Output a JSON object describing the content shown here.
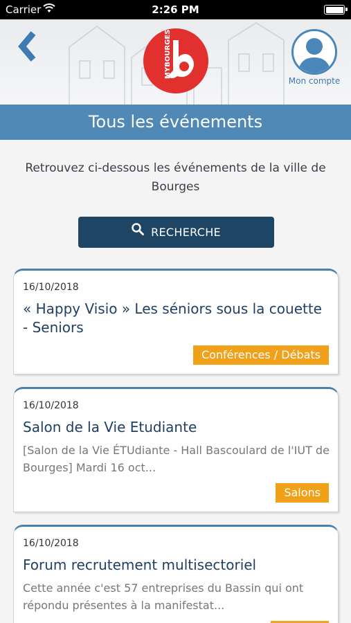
{
  "status_bar": {
    "carrier": "Carrier",
    "time": "2:26 PM"
  },
  "header": {
    "logo_text": "MYBOURGES",
    "account_label": "Mon compte"
  },
  "page": {
    "title": "Tous les événements",
    "intro": "Retrouvez ci-dessous les événements de la ville de Bourges",
    "search_label": "RECHERCHE"
  },
  "events": [
    {
      "date": "16/10/2018",
      "title": "« Happy Visio » Les séniors sous la couette - Seniors",
      "excerpt": "",
      "tag": "Conférences / Débats"
    },
    {
      "date": "16/10/2018",
      "title": "Salon de la Vie Etudiante",
      "excerpt": "[Salon de la Vie ÉTUdiante - Hall Bascoulard de l'IUT de Bourges]    Mardi 16 oct...",
      "tag": "Salons"
    },
    {
      "date": "16/10/2018",
      "title": "Forum recrutement multisectoriel",
      "excerpt": "Cette année c'est  57 entreprises du Bassin qui ont répondu présentes à la manifestat...",
      "tag": ""
    }
  ],
  "colors": {
    "primary": "#5089b5",
    "dark": "#1f4564",
    "accent": "#f0a019",
    "logo_red": "#e2302f"
  },
  "icons": {
    "back": "chevron-left-icon",
    "search": "search-icon",
    "account": "user-avatar-icon",
    "wifi": "wifi-icon",
    "battery": "battery-icon"
  }
}
